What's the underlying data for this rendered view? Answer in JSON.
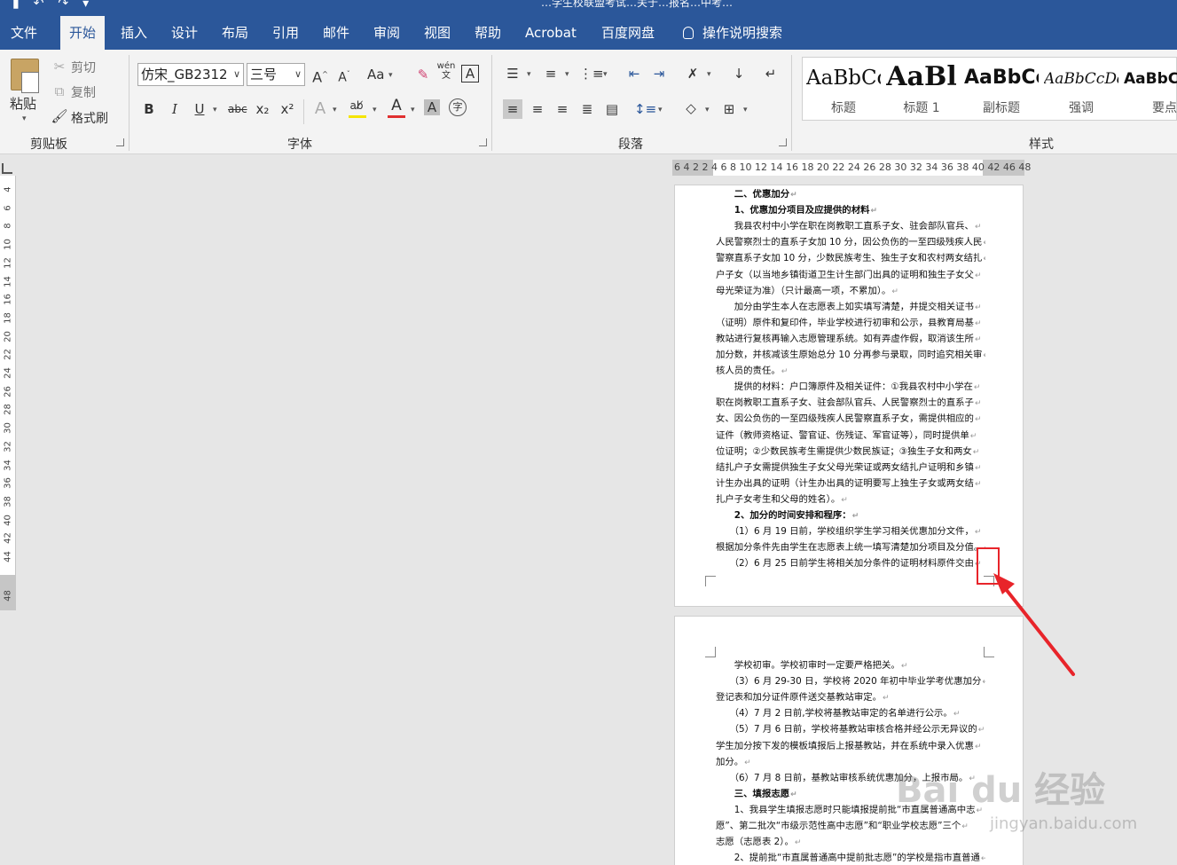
{
  "window": {
    "title": "…学生校联盟考试…关于…报名…中考…",
    "qat_icons": [
      "save-icon",
      "undo-icon",
      "redo-icon"
    ]
  },
  "menu": {
    "tabs": [
      "文件",
      "开始",
      "插入",
      "设计",
      "布局",
      "引用",
      "邮件",
      "审阅",
      "视图",
      "帮助",
      "Acrobat",
      "百度网盘"
    ],
    "active_tab": "开始",
    "tell_me": "操作说明搜索"
  },
  "clipboard": {
    "paste": "粘贴",
    "cut": "剪切",
    "copy": "复制",
    "format_painter": "格式刷",
    "group": "剪贴板"
  },
  "font": {
    "name": "仿宋_GB2312",
    "size": "三号",
    "group": "字体",
    "aa": "Aa",
    "wen": "wén\n文",
    "box_a": "A",
    "bold": "B",
    "italic": "I",
    "underline": "U",
    "strike": "abc",
    "sub": "x₂",
    "sup": "x²",
    "text_effects": "A",
    "font_color": "A",
    "shading": "A",
    "enclose": "字"
  },
  "paragraph": {
    "group": "段落"
  },
  "styles": {
    "group": "样式",
    "items": [
      {
        "sample": "AaBbCcDd",
        "name": "标题"
      },
      {
        "sample": "AaBl",
        "name": "标题 1"
      },
      {
        "sample": "AaBbCc",
        "name": "副标题"
      },
      {
        "sample": "AaBbCcDd",
        "name": "强调"
      },
      {
        "sample": "AaBbCcDd",
        "name": "要点"
      }
    ]
  },
  "ruler": {
    "horizontal": "6  4  2      2  4  6  8 10 12 14 16 18 20 22 24 26 28 30 32 34 36 38 40 42    46 48",
    "vertical": [
      "4",
      "6",
      "8",
      "10",
      "12",
      "14",
      "16",
      "18",
      "20",
      "22",
      "24",
      "26",
      "28",
      "30",
      "32",
      "34",
      "36",
      "38",
      "40",
      "42",
      "44",
      "48"
    ]
  },
  "page1_lines": [
    {
      "t": "　　二、优惠加分",
      "b": true
    },
    {
      "t": "　　1、优惠加分项目及应提供的材料",
      "b": true
    },
    {
      "t": "　　我县农村中小学在职在岗教职工直系子女、驻会部队官兵、",
      "b": false
    },
    {
      "t": "人民警察烈士的直系子女加 10 分，因公负伤的一至四级残疾人民",
      "b": false
    },
    {
      "t": "警察直系子女加 10 分，少数民族考生、独生子女和农村两女结扎",
      "b": false
    },
    {
      "t": "户子女（以当地乡镇街道卫生计生部门出具的证明和独生子女父",
      "b": false
    },
    {
      "t": "母光荣证为准）（只计最高一项，不累加）。",
      "b": false
    },
    {
      "t": "　　加分由学生本人在志愿表上如实填写清楚，并提交相关证书",
      "b": false
    },
    {
      "t": "（证明）原件和复印件，毕业学校进行初审和公示，县教育局基",
      "b": false
    },
    {
      "t": "教站进行复核再输入志愿管理系统。如有弄虚作假，取消该生所",
      "b": false
    },
    {
      "t": "加分数，并核减该生原始总分 10 分再参与录取，同时追究相关审",
      "b": false
    },
    {
      "t": "核人员的责任。",
      "b": false
    },
    {
      "t": "　　提供的材料：户口簿原件及相关证件：①我县农村中小学在",
      "b": false
    },
    {
      "t": "职在岗教职工直系子女、驻会部队官兵、人民警察烈士的直系子",
      "b": false
    },
    {
      "t": "女、因公负伤的一至四级残疾人民警察直系子女，需提供相应的",
      "b": false
    },
    {
      "t": "证件（教师资格证、警官证、伤残证、军官证等），同时提供单",
      "b": false
    },
    {
      "t": "位证明；②少数民族考生需提供少数民族证；③独生子女和两女",
      "b": false
    },
    {
      "t": "结扎户子女需提供独生子女父母光荣证或两女结扎户证明和乡镇",
      "b": false
    },
    {
      "t": "计生办出具的证明（计生办出具的证明要写上独生子女或两女结",
      "b": false
    },
    {
      "t": "扎户子女考生和父母的姓名）。",
      "b": false
    },
    {
      "t": "　　2、加分的时间安排和程序：",
      "b": true
    },
    {
      "t": "　　（1）6 月 19 日前，学校组织学生学习相关优惠加分文件，",
      "b": false
    },
    {
      "t": "根据加分条件先由学生在志愿表上统一填写清楚加分项目及分值。",
      "b": false
    },
    {
      "t": "　　（2）6 月 25 日前学生将相关加分条件的证明材料原件交由",
      "b": false
    }
  ],
  "page2_lines": [
    {
      "t": "　　学校初审。学校初审时一定要严格把关。",
      "b": false
    },
    {
      "t": "　　（3）6 月 29-30 日，学校将 2020 年初中毕业学考优惠加分",
      "b": false
    },
    {
      "t": "登记表和加分证件原件送交基教站审定。",
      "b": false
    },
    {
      "t": "　　（4）7 月 2 日前,学校将基教站审定的名单进行公示。",
      "b": false
    },
    {
      "t": "　　（5）7 月 6 日前，学校将基教站审核合格并经公示无异议的",
      "b": false
    },
    {
      "t": "学生加分按下发的模板填报后上报基教站，并在系统中录入优惠",
      "b": false
    },
    {
      "t": "加分。",
      "b": false
    },
    {
      "t": "　　（6）7 月 8 日前，基教站审核系统优惠加分，上报市局。",
      "b": false
    },
    {
      "t": "　　三、填报志愿",
      "b": true
    },
    {
      "t": "　　1、我县学生填报志愿时只能填报提前批“市直属普通高中志",
      "b": false
    },
    {
      "t": "愿”、第二批次“市级示范性高中志愿”和“职业学校志愿”三个",
      "b": false
    },
    {
      "t": "志愿（志愿表 2）。",
      "b": false
    },
    {
      "t": "　　2、提前批“市直属普通高中提前批志愿”的学校是指市直普通",
      "b": false
    }
  ],
  "watermark": {
    "logo": "Bai du 经验",
    "url": "jingyan.baidu.com"
  },
  "colors": {
    "brand": "#2b579a",
    "annotation": "#e8242a"
  }
}
